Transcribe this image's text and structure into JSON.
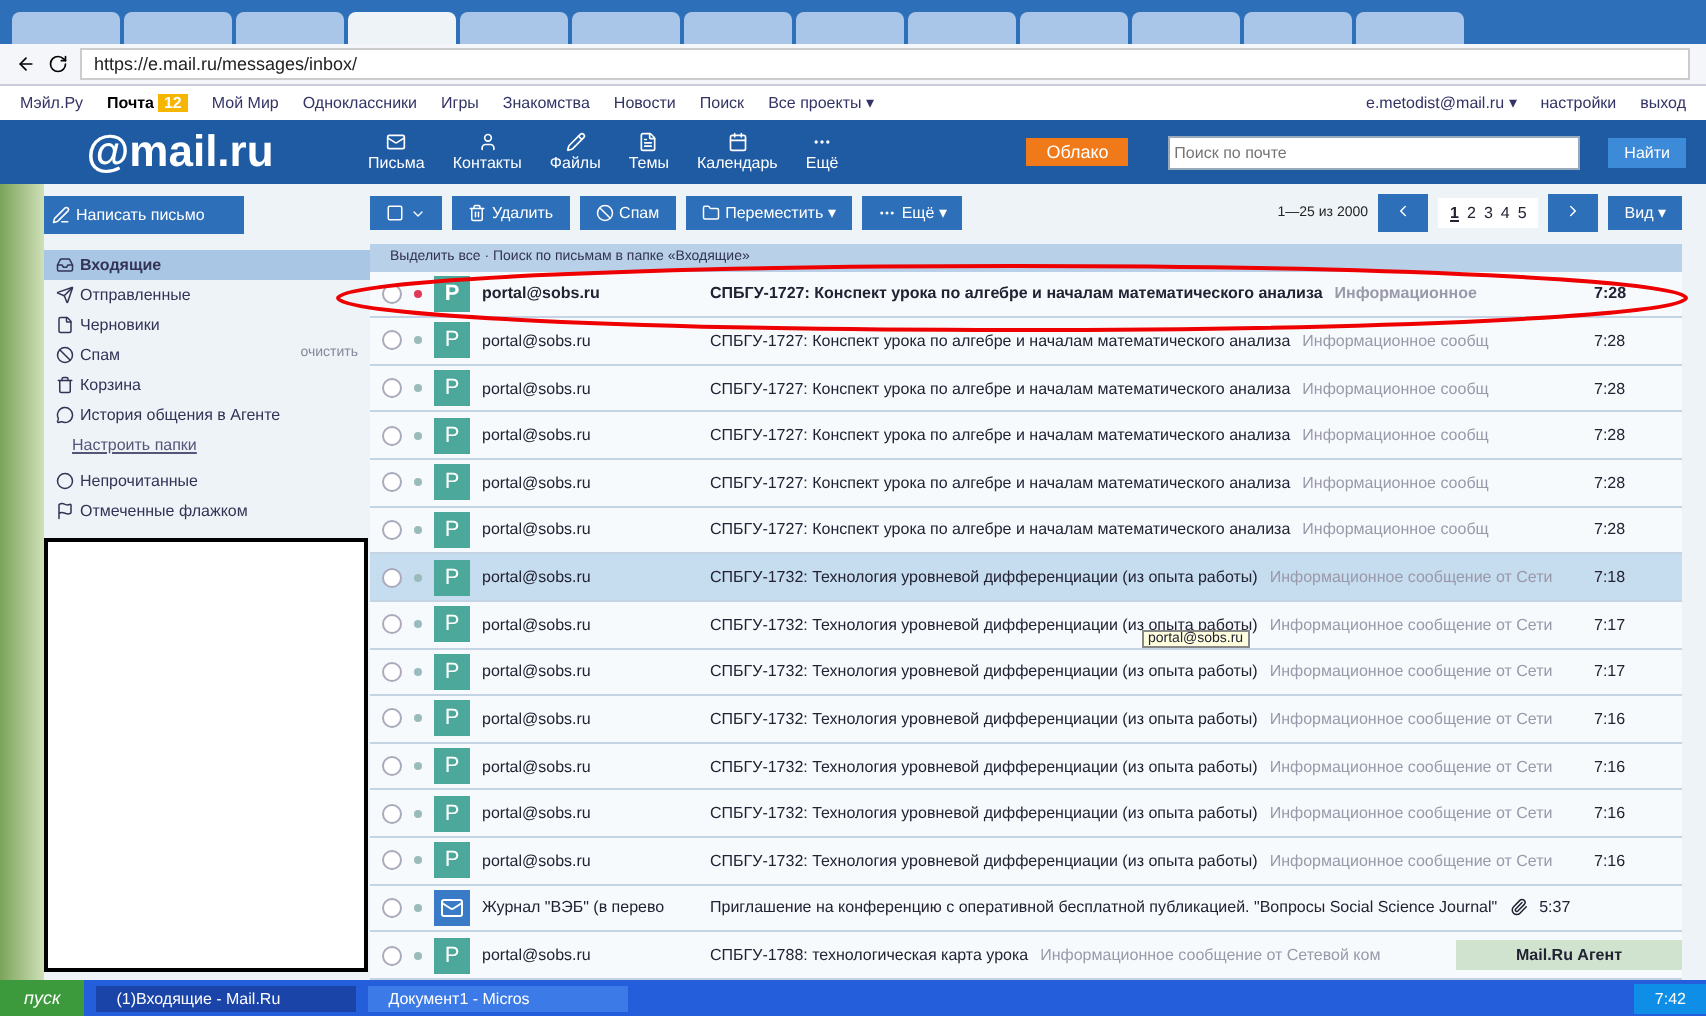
{
  "browser": {
    "tabs": [
      {
        "selected": false
      },
      {
        "selected": false
      },
      {
        "selected": false
      },
      {
        "selected": true
      },
      {
        "selected": false
      },
      {
        "selected": false
      },
      {
        "selected": false
      },
      {
        "selected": false
      },
      {
        "selected": false
      },
      {
        "selected": false
      },
      {
        "selected": false
      },
      {
        "selected": false
      },
      {
        "selected": false
      }
    ],
    "address": "https://e.mail.ru/messages/inbox/"
  },
  "portal_nav": {
    "links": [
      {
        "label": "Мэйл.Ру",
        "selected": false
      },
      {
        "label": "Почта",
        "selected": true
      },
      {
        "label": "Мой Мир",
        "selected": false
      },
      {
        "label": "Одноклассники",
        "selected": false
      },
      {
        "label": "Игры",
        "selected": false
      },
      {
        "label": "Знакомства",
        "selected": false
      },
      {
        "label": "Новости",
        "selected": false
      },
      {
        "label": "Поиск",
        "selected": false
      },
      {
        "label": "Все проекты ▾",
        "selected": false
      }
    ],
    "mail_badge": "12",
    "account": "e.metodist@mail.ru ▾",
    "settings": "настройки",
    "logout": "выход"
  },
  "header": {
    "logo": "@mail.ru",
    "nav": [
      {
        "label": "Письма",
        "kind": "mail"
      },
      {
        "label": "Контакты",
        "kind": "contacts"
      },
      {
        "label": "Файлы",
        "kind": "files"
      },
      {
        "label": "Темы",
        "kind": "themes"
      },
      {
        "label": "Календарь",
        "kind": "calendar"
      },
      {
        "label": "Ещё",
        "kind": "more"
      }
    ],
    "promo": "Облако",
    "search": {
      "placeholder": "Поиск по почте"
    },
    "search_button": "Найти"
  },
  "toolbar": {
    "compose": "Написать письмо",
    "buttons": [
      {
        "label": "Удалить",
        "kind": "delete"
      },
      {
        "label": "Спам",
        "kind": "spam"
      },
      {
        "label": "Переместить ▾",
        "kind": "move"
      },
      {
        "label": "Ещё ▾",
        "kind": "more"
      }
    ],
    "range": "1—25 из 2000",
    "pages": [
      {
        "label": "1",
        "selected": true
      },
      {
        "label": "2",
        "selected": false
      },
      {
        "label": "3",
        "selected": false
      },
      {
        "label": "4",
        "selected": false
      },
      {
        "label": "5",
        "selected": false
      }
    ],
    "view": "Вид ▾"
  },
  "sidebar": {
    "folders": [
      {
        "label": "Входящие",
        "selected": true,
        "kind": "inbox"
      },
      {
        "label": "Отправленные",
        "selected": false,
        "kind": "sent"
      },
      {
        "label": "Черновики",
        "selected": false,
        "kind": "drafts"
      },
      {
        "label": "Спам",
        "selected": false,
        "kind": "spam",
        "action": "очистить"
      },
      {
        "label": "Корзина",
        "selected": false,
        "kind": "trash"
      },
      {
        "label": "История общения в Агенте",
        "selected": false,
        "kind": "agent"
      }
    ],
    "setup": "Настроить папки",
    "filters": [
      {
        "label": "Непрочитанные",
        "kind": "unread"
      },
      {
        "label": "Отмеченные флажком",
        "kind": "flagged"
      }
    ]
  },
  "list_header": "Выделить все  ·  Поиск по письмам в папке «Входящие»",
  "messages": [
    {
      "sender": "portal@sobs.ru",
      "subject": "СПБГУ-1727: Конспект урока по алгебре и началам математического анализа",
      "snippet": "Информационное",
      "time": "7:28",
      "unread": true,
      "selected": false,
      "avatar": "P",
      "kind": "letter"
    },
    {
      "sender": "portal@sobs.ru",
      "subject": "СПБГУ-1727: Конспект урока по алгебре и началам математического анализа",
      "snippet": "Информационное сообщ",
      "time": "7:28",
      "unread": false,
      "selected": false,
      "avatar": "P",
      "kind": "letter"
    },
    {
      "sender": "portal@sobs.ru",
      "subject": "СПБГУ-1727: Конспект урока по алгебре и началам математического анализа",
      "snippet": "Информационное сообщ",
      "time": "7:28",
      "unread": false,
      "selected": false,
      "avatar": "P",
      "kind": "letter"
    },
    {
      "sender": "portal@sobs.ru",
      "subject": "СПБГУ-1727: Конспект урока по алгебре и началам математического анализа",
      "snippet": "Информационное сообщ",
      "time": "7:28",
      "unread": false,
      "selected": false,
      "avatar": "P",
      "kind": "letter"
    },
    {
      "sender": "portal@sobs.ru",
      "subject": "СПБГУ-1727: Конспект урока по алгебре и началам математического анализа",
      "snippet": "Информационное сообщ",
      "time": "7:28",
      "unread": false,
      "selected": false,
      "avatar": "P",
      "kind": "letter"
    },
    {
      "sender": "portal@sobs.ru",
      "subject": "СПБГУ-1727: Конспект урока по алгебре и началам математического анализа",
      "snippet": "Информационное сообщ",
      "time": "7:28",
      "unread": false,
      "selected": false,
      "avatar": "P",
      "kind": "letter"
    },
    {
      "sender": "portal@sobs.ru",
      "subject": "СПБГУ-1732: Технология уровневой дифференциации (из опыта работы)",
      "snippet": "Информационное сообщение от Сети",
      "time": "7:18",
      "unread": false,
      "selected": true,
      "avatar": "P",
      "kind": "letter"
    },
    {
      "sender": "portal@sobs.ru",
      "subject": "СПБГУ-1732: Технология уровневой дифференциации (из опыта работы)",
      "snippet": "Информационное сообщение от Сети",
      "time": "7:17",
      "unread": false,
      "selected": false,
      "avatar": "P",
      "kind": "letter",
      "tooltip": "portal@sobs.ru"
    },
    {
      "sender": "portal@sobs.ru",
      "subject": "СПБГУ-1732: Технология уровневой дифференциации (из опыта работы)",
      "snippet": "Информационное сообщение от Сети",
      "time": "7:17",
      "unread": false,
      "selected": false,
      "avatar": "P",
      "kind": "letter"
    },
    {
      "sender": "portal@sobs.ru",
      "subject": "СПБГУ-1732: Технология уровневой дифференциации (из опыта работы)",
      "snippet": "Информационное сообщение от Сети",
      "time": "7:16",
      "unread": false,
      "selected": false,
      "avatar": "P",
      "kind": "letter"
    },
    {
      "sender": "portal@sobs.ru",
      "subject": "СПБГУ-1732: Технология уровневой дифференциации (из опыта работы)",
      "snippet": "Информационное сообщение от Сети",
      "time": "7:16",
      "unread": false,
      "selected": false,
      "avatar": "P",
      "kind": "letter"
    },
    {
      "sender": "portal@sobs.ru",
      "subject": "СПБГУ-1732: Технология уровневой дифференциации (из опыта работы)",
      "snippet": "Информационное сообщение от Сети",
      "time": "7:16",
      "unread": false,
      "selected": false,
      "avatar": "P",
      "kind": "letter"
    },
    {
      "sender": "portal@sobs.ru",
      "subject": "СПБГУ-1732: Технология уровневой дифференциации (из опыта работы)",
      "snippet": "Информационное сообщение от Сети",
      "time": "7:16",
      "unread": false,
      "selected": false,
      "avatar": "P",
      "kind": "letter"
    },
    {
      "sender": "Журнал \"ВЭБ\" (в перево",
      "subject": "Приглашение на конференцию с оперативной бесплатной публикацией. \"Вопросы Social Science Journal\"",
      "time": "5:37",
      "unread": false,
      "selected": false,
      "kind": "journal",
      "attachment": true
    },
    {
      "sender": "portal@sobs.ru",
      "subject": "СПБГУ-1788: технологическая карта урока",
      "snippet": "Информационное сообщение от Сетевой ком",
      "unread": false,
      "selected": false,
      "avatar": "P",
      "kind": "letter"
    }
  ],
  "agent_bar": {
    "label": "Mail.Ru Агент"
  },
  "taskbar": {
    "start": "пуск",
    "windows": [
      {
        "label": "(1)Входящие - Mail.Ru",
        "selected": true
      },
      {
        "label": "Документ1 - Micros",
        "selected": false
      }
    ],
    "clock": "7:42"
  }
}
